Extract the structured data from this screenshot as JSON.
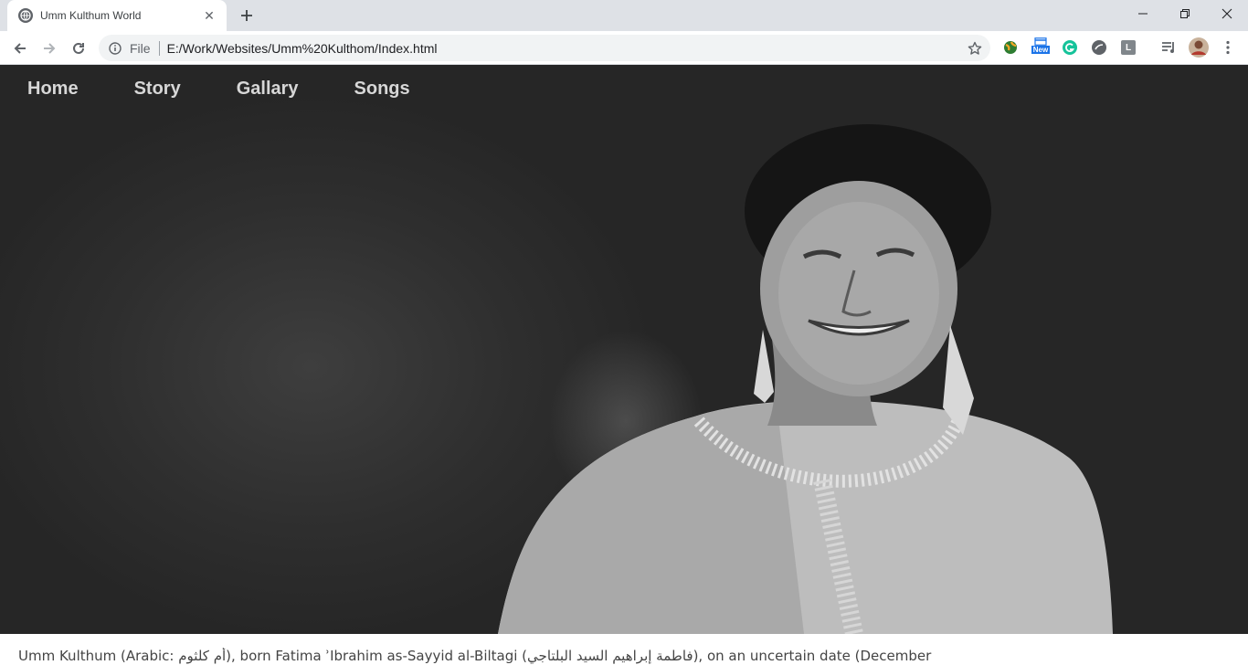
{
  "browser": {
    "tab": {
      "title": "Umm Kulthum World",
      "close_glyph": "✕"
    },
    "new_tab_glyph": "+",
    "window_controls": {
      "minimize": "minimize-icon",
      "restore": "restore-icon",
      "close": "close-icon"
    },
    "omnibox": {
      "scheme_label": "File",
      "url": "E:/Work/Websites/Umm%20Kulthom/Index.html"
    },
    "extensions": {
      "badge_new": "New",
      "profile_letter": "L"
    }
  },
  "page": {
    "nav": [
      {
        "label": "Home"
      },
      {
        "label": "Story"
      },
      {
        "label": "Gallary"
      },
      {
        "label": "Songs"
      }
    ],
    "hero_image_alt": "Umm Kulthum portrait",
    "intro_text": "Umm Kulthum (Arabic: أم كلثوم), born Fatima ʾIbrahim as-Sayyid al-Biltagi (فاطمة إبراهيم السيد البلتاجي), on an uncertain date (December"
  },
  "colors": {
    "tabstrip_bg": "#dee1e6",
    "omnibox_bg": "#f1f3f4",
    "hero_bg": "#2a2a2a",
    "nav_text": "#d7d7d7",
    "body_text": "#444444"
  }
}
